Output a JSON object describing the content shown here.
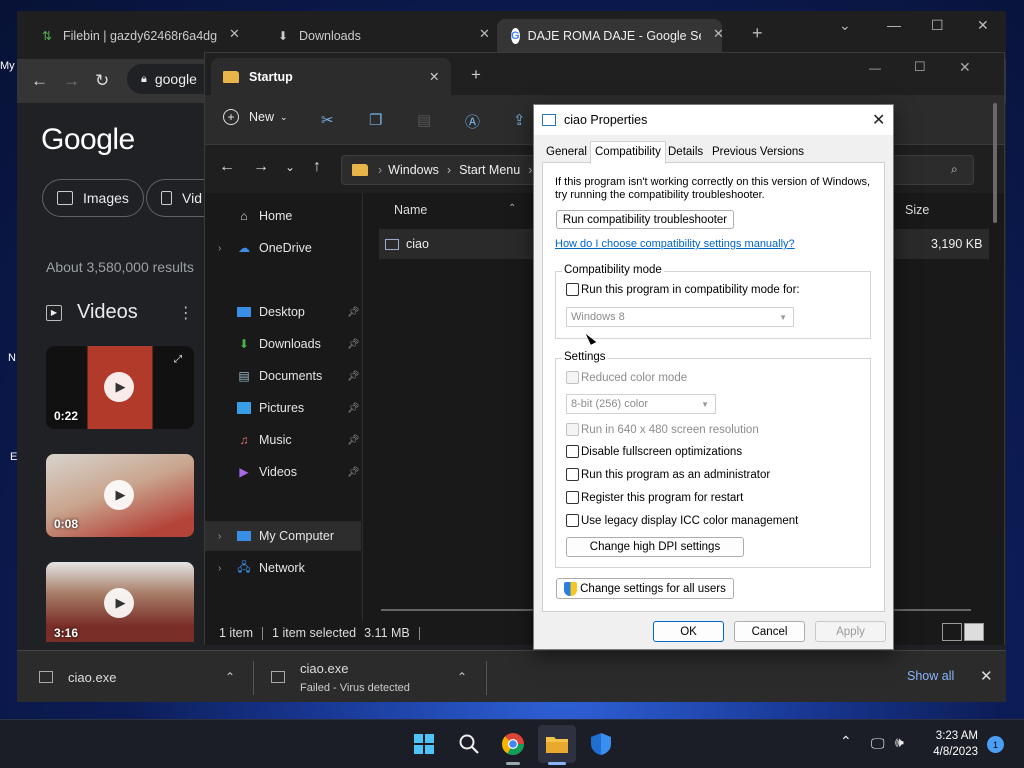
{
  "chrome": {
    "tabs": [
      {
        "title": "Filebin | gazdy62468r6a4dg"
      },
      {
        "title": "Downloads"
      },
      {
        "title": "DAJE ROMA DAJE - Google Sear"
      }
    ],
    "omnibox_text": "google",
    "page": {
      "logo": "Google",
      "chips": [
        "Images",
        "Vid"
      ],
      "result_count": "About 3,580,000 results",
      "videos_heading": "Videos",
      "videos": [
        {
          "duration": "0:22"
        },
        {
          "duration": "0:08"
        },
        {
          "duration": "3:16"
        }
      ]
    },
    "downloads_shelf": {
      "items": [
        {
          "name": "ciao.exe",
          "status": ""
        },
        {
          "name": "ciao.exe",
          "status": "Failed - Virus detected"
        }
      ],
      "show_all": "Show all"
    }
  },
  "explorer": {
    "tab_title": "Startup",
    "new_label": "New",
    "breadcrumb": [
      "Windows",
      "Start Menu"
    ],
    "nav": {
      "home": "Home",
      "onedrive": "OneDrive",
      "pinned": [
        "Desktop",
        "Downloads",
        "Documents",
        "Pictures",
        "Music",
        "Videos"
      ],
      "my_computer": "My Computer",
      "network": "Network"
    },
    "columns": {
      "name": "Name",
      "size": "Size"
    },
    "files": [
      {
        "name": "ciao",
        "size": "3,190 KB"
      }
    ],
    "status": {
      "count": "1 item",
      "selected": "1 item selected",
      "size": "3.11 MB"
    }
  },
  "dialog": {
    "title": "ciao Properties",
    "tabs": [
      "General",
      "Compatibility",
      "Details",
      "Previous Versions"
    ],
    "intro": "If this program isn't working correctly on this version of Windows, try running the compatibility troubleshooter.",
    "troubleshooter_btn": "Run compatibility troubleshooter",
    "manual_link": "How do I choose compatibility settings manually?",
    "compat_group": {
      "label": "Compatibility mode",
      "checkbox": "Run this program in compatibility mode for:",
      "select_value": "Windows 8"
    },
    "settings_group": {
      "label": "Settings",
      "reduced_color": "Reduced color mode",
      "color_select": "8-bit (256) color",
      "res_640": "Run in 640 x 480 screen resolution",
      "fullscreen_opt": "Disable fullscreen optimizations",
      "run_admin": "Run this program as an administrator",
      "register_restart": "Register this program for restart",
      "legacy_icc": "Use legacy display ICC color management",
      "dpi_btn": "Change high DPI settings"
    },
    "all_users_btn": "Change settings for all users",
    "ok": "OK",
    "cancel": "Cancel",
    "apply": "Apply"
  },
  "taskbar": {
    "time": "3:23 AM",
    "date": "4/8/2023",
    "notifications": "1"
  },
  "desktop": {
    "fragments": [
      "My",
      "N",
      "E"
    ]
  },
  "colors": {
    "accent": "#0067c0",
    "link": "#0064c8",
    "folder": "#e8b54a"
  }
}
